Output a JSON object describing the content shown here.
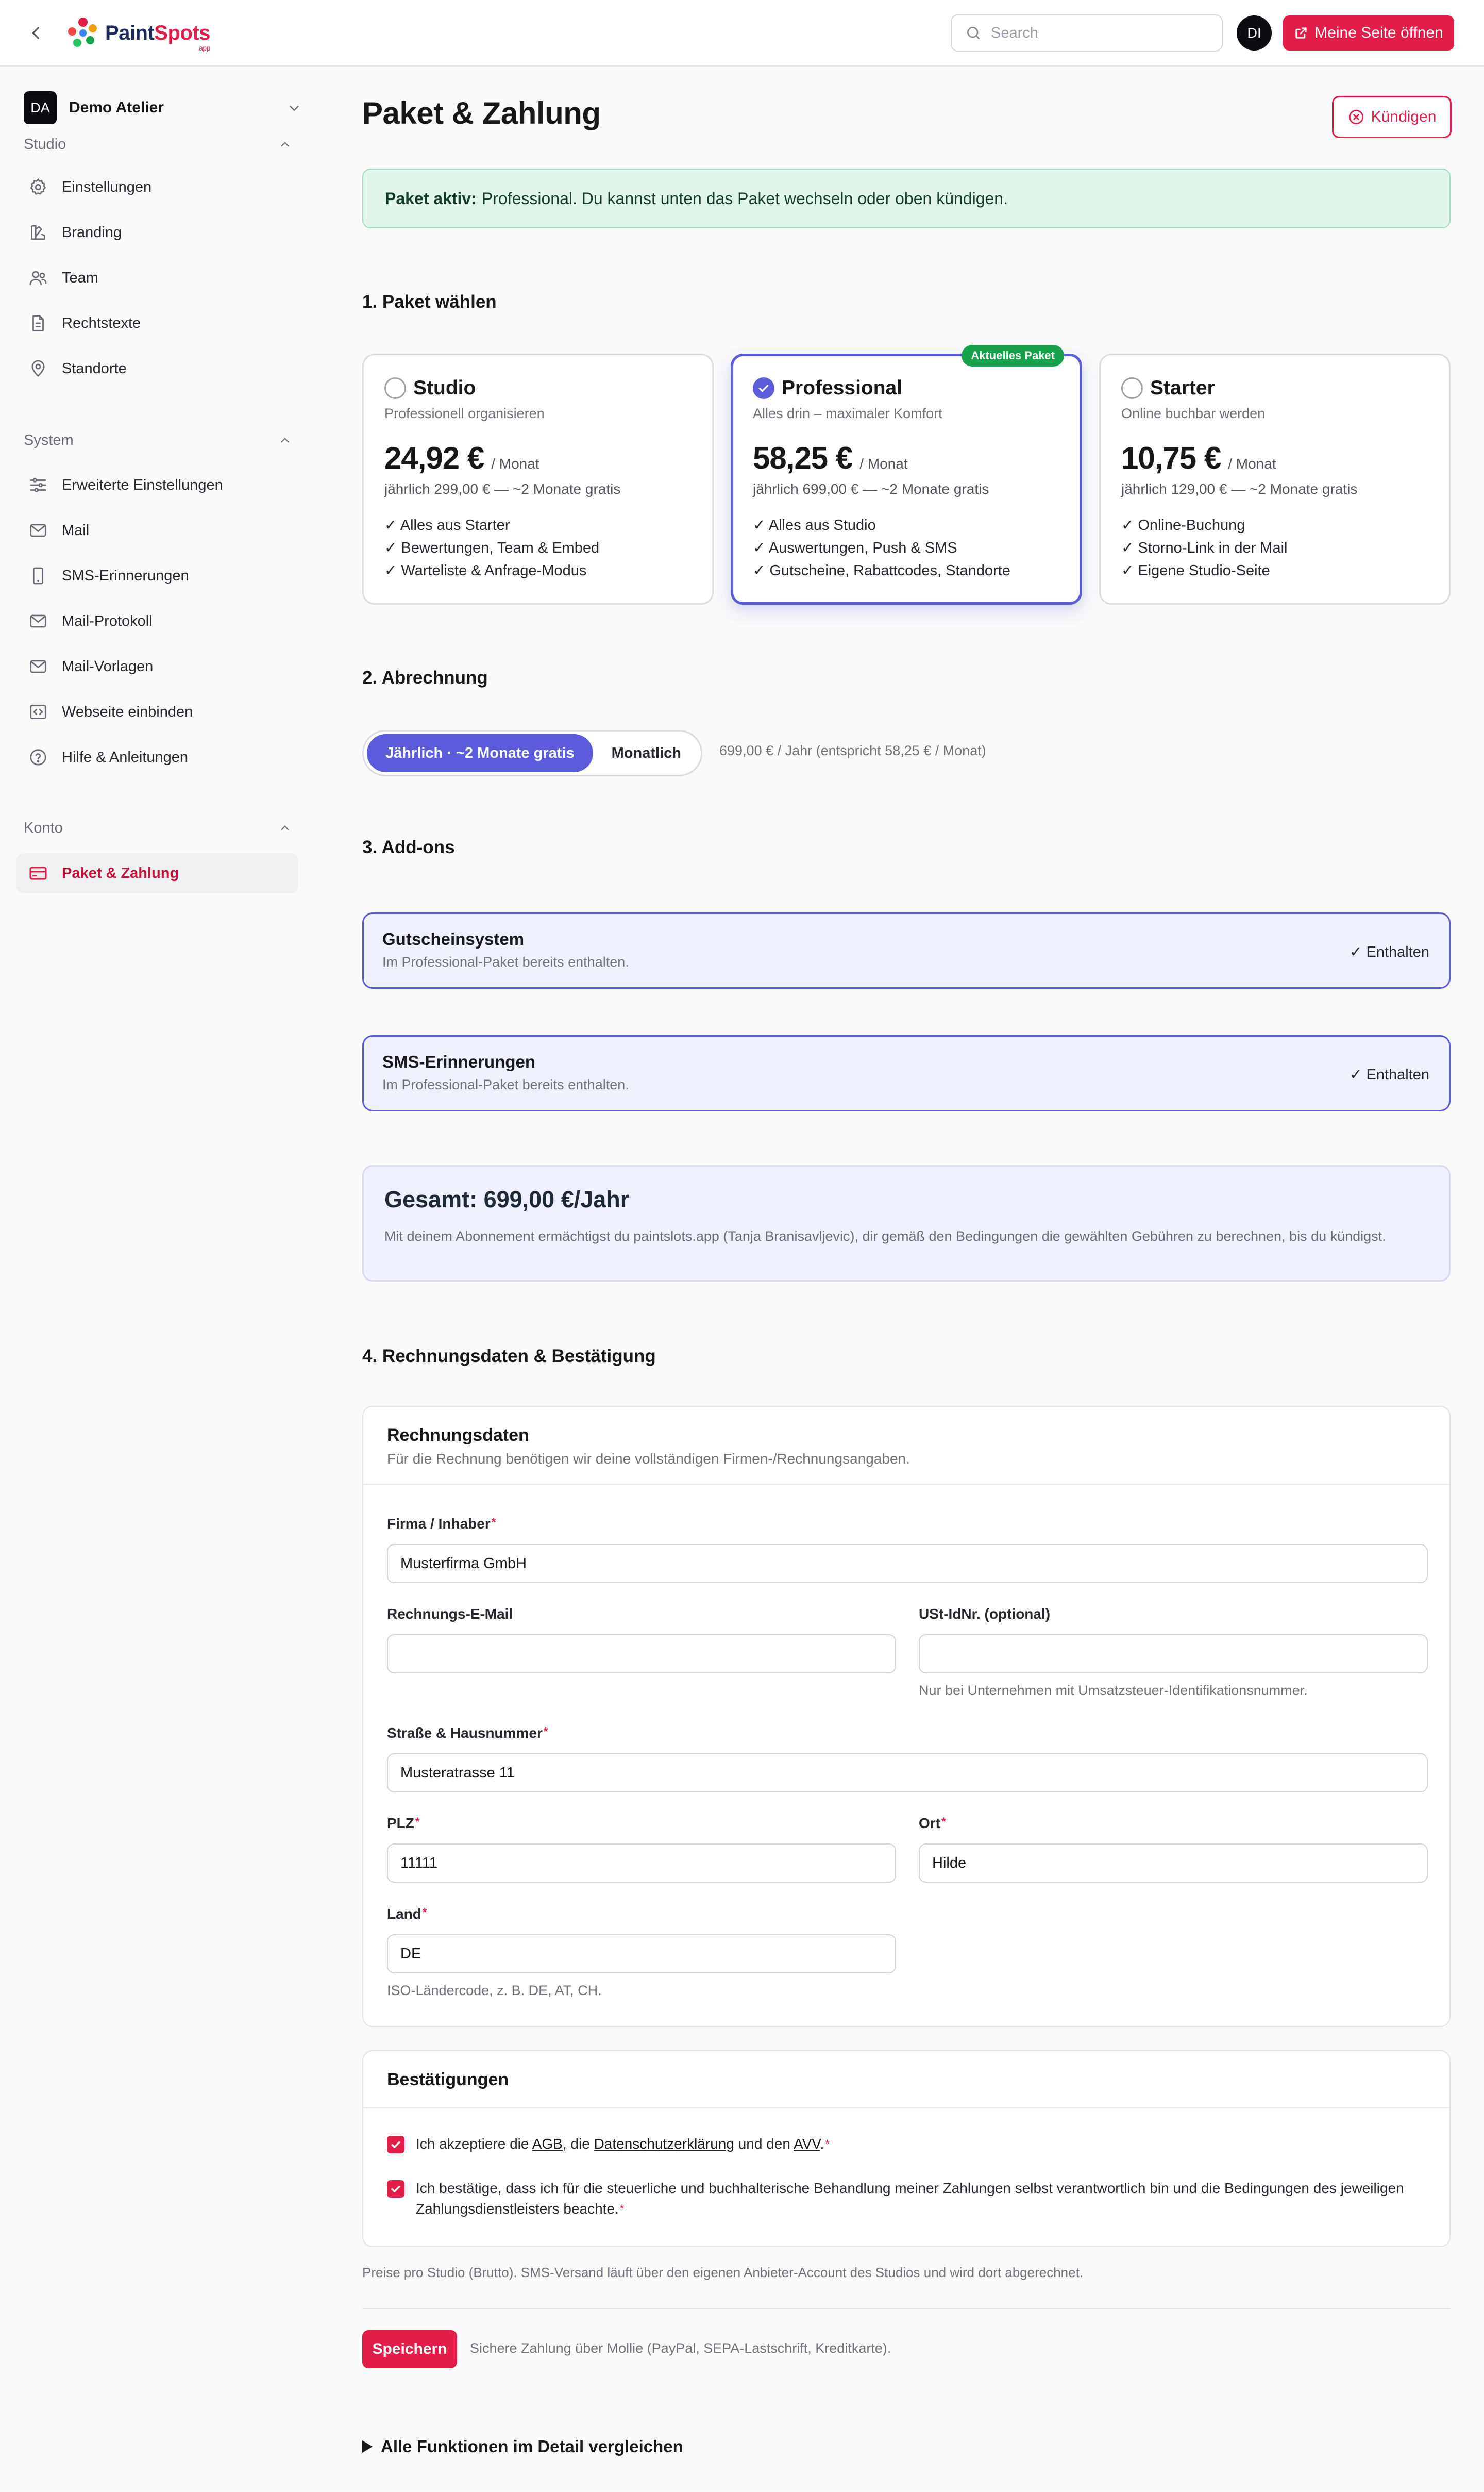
{
  "app": {
    "logo_text_1": "Paint",
    "logo_text_2": "Spots",
    "logo_sub": ".app",
    "search_placeholder": "Search",
    "user_initials": "DI",
    "open_page_label": "Meine Seite öffnen"
  },
  "colors": {
    "brand": "#e11d48",
    "accent": "#5b5bdc",
    "success": "#16a34a"
  },
  "sidebar": {
    "studio_initials": "DA",
    "studio_name": "Demo Atelier",
    "groups": [
      {
        "title": "Studio",
        "items": [
          {
            "label": "Einstellungen",
            "icon": "gear-icon"
          },
          {
            "label": "Branding",
            "icon": "palette-icon"
          },
          {
            "label": "Team",
            "icon": "users-icon"
          },
          {
            "label": "Rechtstexte",
            "icon": "document-icon"
          },
          {
            "label": "Standorte",
            "icon": "map-pin-icon"
          }
        ]
      },
      {
        "title": "System",
        "items": [
          {
            "label": "Erweiterte Einstellungen",
            "icon": "sliders-icon"
          },
          {
            "label": "Mail",
            "icon": "mail-icon"
          },
          {
            "label": "SMS-Erinnerungen",
            "icon": "phone-icon"
          },
          {
            "label": "Mail-Protokoll",
            "icon": "mail-log-icon"
          },
          {
            "label": "Mail-Vorlagen",
            "icon": "mail-template-icon"
          },
          {
            "label": "Webseite einbinden",
            "icon": "code-icon"
          },
          {
            "label": "Hilfe & Anleitungen",
            "icon": "help-icon"
          }
        ]
      },
      {
        "title": "Konto",
        "items": [
          {
            "label": "Paket & Zahlung",
            "icon": "credit-card-icon",
            "active": true
          }
        ]
      }
    ]
  },
  "page": {
    "title": "Paket & Zahlung",
    "cancel_label": "Kündigen",
    "alert_strong": "Paket aktiv:",
    "alert_text": "Professional. Du kannst unten das Paket wechseln oder oben kündigen."
  },
  "plans": {
    "heading": "1. Paket wählen",
    "current_badge": "Aktuelles Paket",
    "items": [
      {
        "name": "Studio",
        "tagline": "Professionell organisieren",
        "price": "24,92 €",
        "per": "/ Monat",
        "yearly": "jährlich 299,00 € — ~2 Monate gratis",
        "features": [
          "✓ Alles aus Starter",
          "✓ Bewertungen, Team & Embed",
          "✓ Warteliste & Anfrage-Modus"
        ],
        "selected": false
      },
      {
        "name": "Professional",
        "tagline": "Alles drin – maximaler Komfort",
        "price": "58,25 €",
        "per": "/ Monat",
        "yearly": "jährlich 699,00 € — ~2 Monate gratis",
        "features": [
          "✓ Alles aus Studio",
          "✓ Auswertungen, Push & SMS",
          "✓ Gutscheine, Rabattcodes, Standorte"
        ],
        "selected": true
      },
      {
        "name": "Starter",
        "tagline": "Online buchbar werden",
        "price": "10,75 €",
        "per": "/ Monat",
        "yearly": "jährlich 129,00 € — ~2 Monate gratis",
        "features": [
          "✓ Online-Buchung",
          "✓ Storno-Link in der Mail",
          "✓ Eigene Studio-Seite"
        ],
        "selected": false
      }
    ]
  },
  "billing": {
    "heading": "2. Abrechnung",
    "option_yearly": "Jährlich · ~2 Monate gratis",
    "option_monthly": "Monatlich",
    "note": "699,00 € / Jahr (entspricht 58,25 € / Monat)"
  },
  "addons": {
    "heading": "3. Add-ons",
    "items": [
      {
        "title": "Gutscheinsystem",
        "desc": "Im Professional-Paket bereits enthalten.",
        "state": "✓ Enthalten"
      },
      {
        "title": "SMS-Erinnerungen",
        "desc": "Im Professional-Paket bereits enthalten.",
        "state": "✓ Enthalten"
      }
    ]
  },
  "total": {
    "title": "Gesamt: 699,00 €/Jahr",
    "text": "Mit deinem Abonnement ermächtigst du paintslots.app (Tanja Branisavljevic), dir gemäß den Bedingungen die gewählten Gebühren zu berechnen, bis du kündigst."
  },
  "invoice": {
    "heading": "4. Rechnungsdaten & Bestätigung",
    "card_title": "Rechnungsdaten",
    "card_sub": "Für die Rechnung benötigen wir deine vollständigen Firmen-/Rechnungsangaben.",
    "company_label": "Firma / Inhaber",
    "company_value": "Musterfirma GmbH",
    "email_label": "Rechnungs-E-Mail",
    "email_value": "",
    "vat_label": "USt-IdNr. (optional)",
    "vat_value": "",
    "vat_hint": "Nur bei Unternehmen mit Umsatzsteuer-Identifikationsnummer.",
    "street_label": "Straße & Hausnummer",
    "street_value": "Musteratrasse 11",
    "zip_label": "PLZ",
    "zip_value": "11111",
    "city_label": "Ort",
    "city_value": "Hilde",
    "country_label": "Land",
    "country_value": "DE",
    "country_hint": "ISO-Ländercode, z. B. DE, AT, CH."
  },
  "confirmations": {
    "title": "Bestätigungen",
    "terms_prefix": "Ich akzeptiere die ",
    "terms_agb": "AGB",
    "terms_mid": ", die ",
    "terms_privacy": "Datenschutzerklärung",
    "terms_and": " und den ",
    "terms_avv": "AVV",
    "terms_end": ".",
    "tax_text": "Ich bestätige, dass ich für die steuerliche und buchhalterische Behandlung meiner Zahlungen selbst verantwortlich bin und die Bedingungen des jeweiligen Zahlungsdienstleisters beachte."
  },
  "footer": {
    "note": "Preise pro Studio (Brutto). SMS-Versand läuft über den eigenen Anbieter-Account des Studios und wird dort abgerechnet.",
    "save_label": "Speichern",
    "save_note": "Sichere Zahlung über Mollie (PayPal, SEPA-Lastschrift, Kreditkarte).",
    "compare_label": "Alle Funktionen im Detail vergleichen"
  }
}
